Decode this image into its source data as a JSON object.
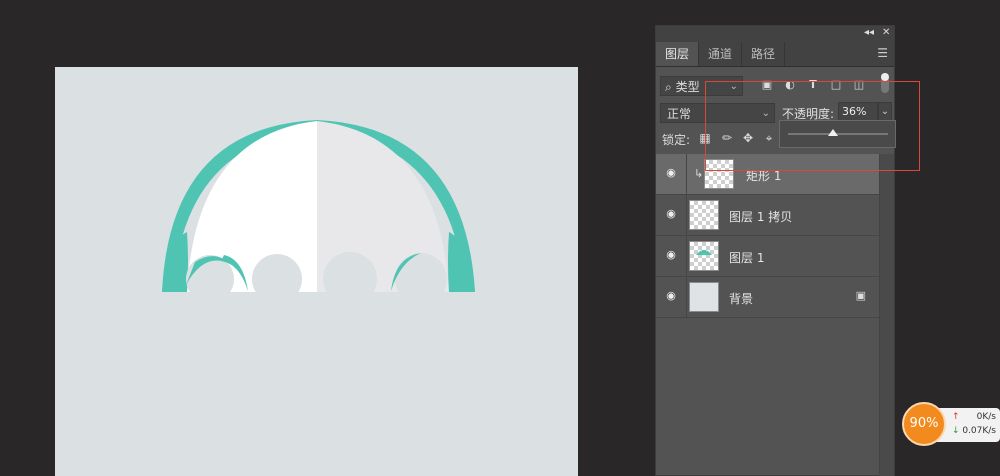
{
  "panel": {
    "controls": {
      "collapse": "◂◂",
      "close": "✕"
    },
    "tabs": [
      {
        "label": "图层",
        "active": true
      },
      {
        "label": "通道",
        "active": false
      },
      {
        "label": "路径",
        "active": false
      }
    ],
    "menu_icon": "menu-icon",
    "filter": {
      "search_icon": "⌕",
      "value": "类型"
    },
    "filter_icons": [
      "image-filter-icon",
      "adjustment-filter-icon",
      "type-filter-icon",
      "shape-filter-icon",
      "smart-object-filter-icon"
    ],
    "blend_mode": "正常",
    "opacity": {
      "label": "不透明度:",
      "value": "36%"
    },
    "opacity_slider_value": 0.36,
    "lock_label": "锁定:",
    "layers": [
      {
        "name": "矩形 1",
        "selected": true,
        "clipped": true
      },
      {
        "name": "图层 1 拷贝",
        "selected": false
      },
      {
        "name": "图层 1",
        "selected": false
      },
      {
        "name": "背景",
        "selected": false,
        "locked": true
      }
    ]
  },
  "canvas": {
    "background": "#dbe0e3",
    "accent": "#4fc4b3",
    "umbrella_white": "#ffffff",
    "umbrella_grey": "#e8e8eb"
  },
  "net_widget": {
    "percent": "90%",
    "upload": "0K/s",
    "download": "0.07K/s"
  }
}
